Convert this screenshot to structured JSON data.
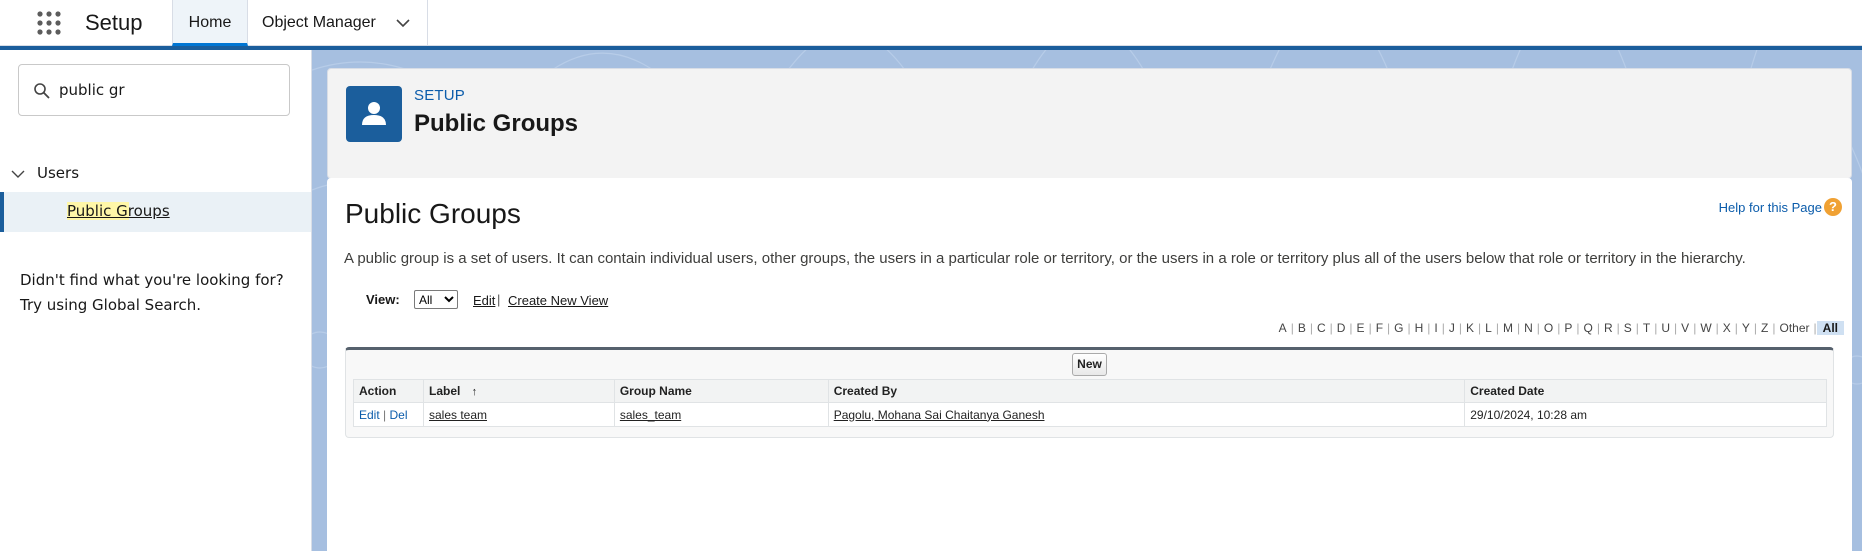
{
  "topbar": {
    "app_title": "Setup",
    "tabs": [
      {
        "label": "Home",
        "active": true
      },
      {
        "label": "Object Manager",
        "active": false
      }
    ]
  },
  "sidebar": {
    "search": {
      "value": "public gr",
      "placeholder": "Quick Find"
    },
    "tree": {
      "group_label": "Users",
      "items": [
        {
          "label": "Public Groups",
          "selected": true,
          "highlight": "Public Gr"
        }
      ]
    },
    "not_found": {
      "line1": "Didn't find what you're looking for?",
      "line2": "Try using Global Search."
    }
  },
  "header": {
    "eyebrow": "SETUP",
    "title": "Public Groups",
    "icon": "user-icon"
  },
  "content": {
    "title": "Public Groups",
    "help_link": "Help for this Page",
    "help_icon": "?",
    "description": "A public group is a set of users. It can contain individual users, other groups, the users in a particular role or territory, or the users in a role or territory plus all of the users below that role or territory in the hierarchy.",
    "view": {
      "label": "View:",
      "selected": "All",
      "edit_label": "Edit",
      "separator": "|",
      "create_label": "Create New View"
    },
    "alphabet": [
      "A",
      "B",
      "C",
      "D",
      "E",
      "F",
      "G",
      "H",
      "I",
      "J",
      "K",
      "L",
      "M",
      "N",
      "O",
      "P",
      "Q",
      "R",
      "S",
      "T",
      "U",
      "V",
      "W",
      "X",
      "Y",
      "Z",
      "Other",
      "All"
    ],
    "alphabet_active": "All",
    "new_button": "New",
    "table": {
      "columns": [
        "Action",
        "Label",
        "Group Name",
        "Created By",
        "Created Date"
      ],
      "sort_indicator": "↑",
      "rows": [
        {
          "edit": "Edit",
          "sep": "|",
          "del": "Del",
          "label": "sales team",
          "group_name": "sales_team",
          "created_by": "Pagolu, Mohana Sai Chaitanya Ganesh",
          "created_date": "29/10/2024, 10:28 am"
        }
      ]
    }
  },
  "colors": {
    "brand_blue": "#1b5e9c",
    "link_blue": "#0b5cab",
    "background_blue": "#a6bfe0",
    "help_orange": "#f0a133"
  }
}
